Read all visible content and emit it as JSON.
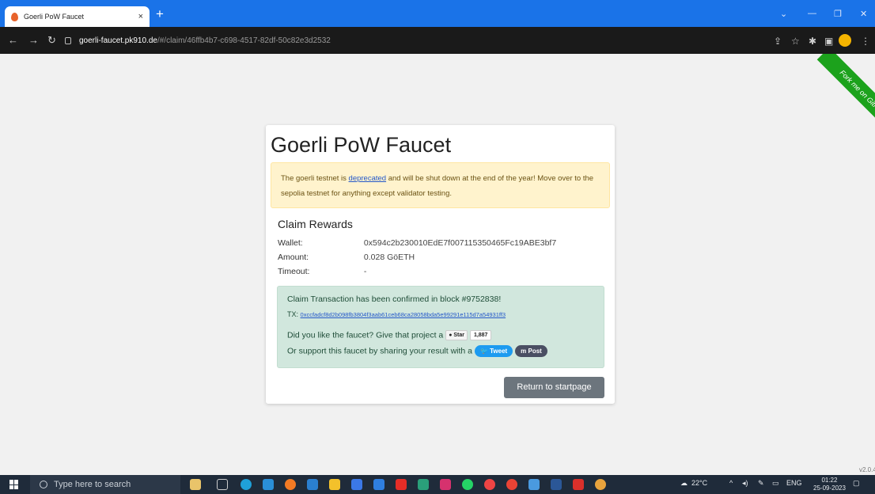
{
  "browser": {
    "tab_title": "Goerli PoW Faucet",
    "tab_close": "×",
    "new_tab": "+",
    "url_host": "goerli-faucet.pk910.de",
    "url_path": "/#/claim/46ffb4b7-c698-4517-82df-50c82e3d2532"
  },
  "ribbon": {
    "text": "Fork me on GitHub"
  },
  "page": {
    "title": "Goerli PoW Faucet",
    "alert": {
      "before_link": "The goerli testnet is ",
      "link": "deprecated",
      "after_link": " and will be shut down at the end of the year! Move over to the sepolia testnet for anything except validator testing."
    },
    "claim": {
      "title": "Claim Rewards",
      "wallet_label": "Wallet:",
      "wallet_value": "0x594c2b230010EdE7f007115350465Fc19ABE3bf7",
      "amount_label": "Amount:",
      "amount_value": "0.028 GöETH",
      "timeout_label": "Timeout:",
      "timeout_value": "-"
    },
    "success": {
      "confirmed": "Claim Transaction has been confirmed in block #9752838!",
      "tx_label": "TX:",
      "tx_hash": "0xccfadcf8d2b098fb3804f3aab61ceb68ca28058bda5e99291e115d7a54931ff3",
      "like_text": "Did you like the faucet? Give that project a",
      "star_label": "Star",
      "star_count": "1,887",
      "share_text": "Or support this faucet by sharing your result with a",
      "tweet_label": "Tweet",
      "post_label": "Post"
    },
    "return_button": "Return to startpage",
    "version": "v2.0.4"
  },
  "taskbar": {
    "search_placeholder": "Type here to search",
    "weather": "22°C",
    "language": "ENG",
    "time": "01:22",
    "date": "25-09-2023"
  }
}
